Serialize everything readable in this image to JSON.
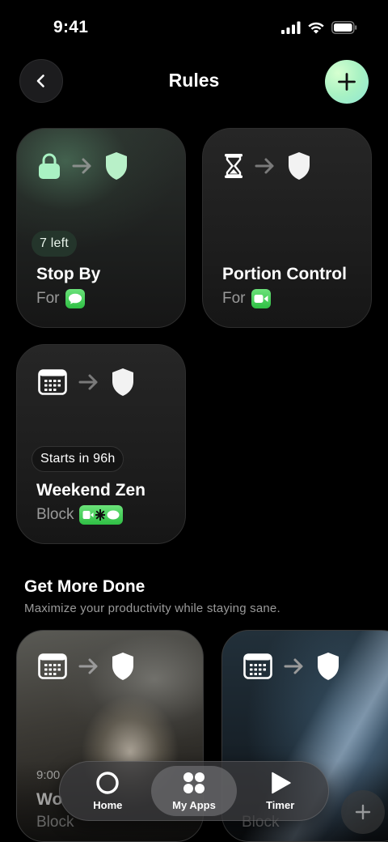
{
  "status_bar": {
    "time": "9:41"
  },
  "header": {
    "title": "Rules"
  },
  "rules": [
    {
      "pill": "7 left",
      "title": "Stop By",
      "sub": "For"
    },
    {
      "title": "Portion Control",
      "sub": "For"
    },
    {
      "pill": "Starts in 96h",
      "title": "Weekend Zen",
      "sub": "Block"
    }
  ],
  "section": {
    "title": "Get More Done",
    "subtitle": "Maximize your productivity while staying sane."
  },
  "templates": [
    {
      "small": "9:00",
      "title": "Wo",
      "sub": "Block"
    },
    {
      "small": "",
      "title": "",
      "sub": "Block"
    }
  ],
  "tab_bar": {
    "tabs": [
      {
        "label": "Home",
        "icon": "circle-icon"
      },
      {
        "label": "My Apps",
        "icon": "grid-icon"
      },
      {
        "label": "Timer",
        "icon": "play-icon"
      }
    ]
  },
  "colors": {
    "accent": "#a9f2c3",
    "app_badge": "#34c759"
  }
}
